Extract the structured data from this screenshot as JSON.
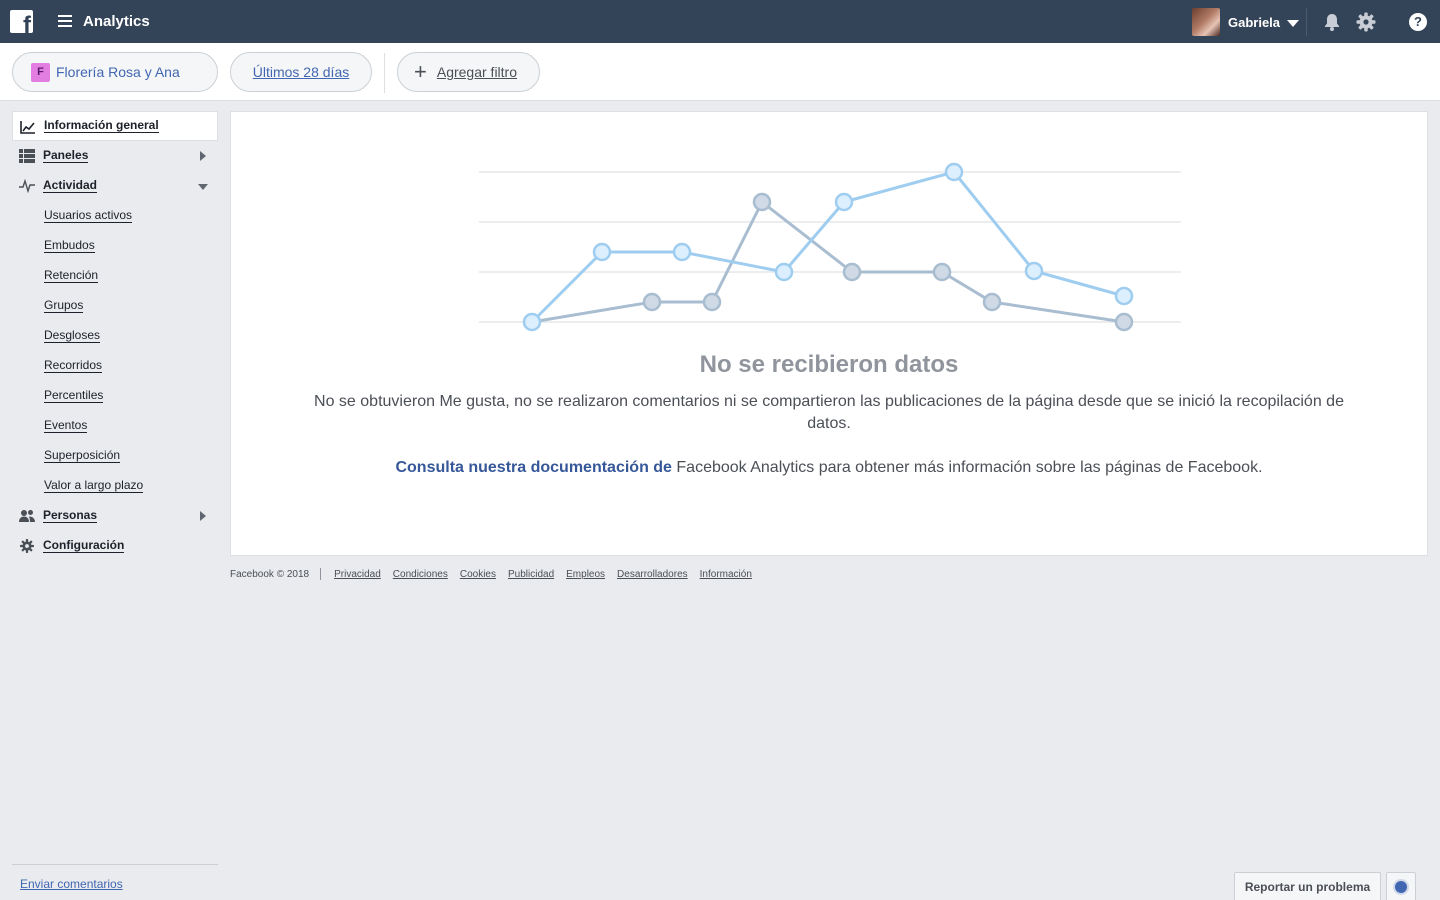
{
  "header": {
    "app_title": "Analytics",
    "user_name": "Gabriela",
    "icons": [
      "facebook-logo-icon",
      "menu-icon",
      "bell-icon",
      "gear-icon",
      "help-icon"
    ]
  },
  "filters": {
    "page_badge": "F",
    "page_name": "Florería Rosa y Ana",
    "date_range": "Últimos 28 días",
    "add_filter": "Agregar filtro"
  },
  "sidebar": {
    "overview": "Información general",
    "panels": "Paneles",
    "activity": "Actividad",
    "activity_items": [
      "Usuarios activos",
      "Embudos",
      "Retención",
      "Grupos",
      "Desgloses",
      "Recorridos",
      "Percentiles",
      "Eventos",
      "Superposición",
      "Valor a largo plazo"
    ],
    "people": "Personas",
    "settings": "Configuración",
    "feedback": "Enviar comentarios"
  },
  "empty_state": {
    "title": "No se recibieron datos",
    "description": "No se obtuvieron Me gusta, no se realizaron comentarios ni se compartieron las publicaciones de la página desde que se inició la recopilación de datos.",
    "doc_link": "Consulta nuestra documentación de",
    "doc_rest": " Facebook Analytics para obtener más información sobre las páginas de Facebook."
  },
  "footer": {
    "copyright": "Facebook © 2018",
    "links": [
      "Privacidad",
      "Condiciones",
      "Cookies",
      "Publicidad",
      "Empleos",
      "Desarrolladores",
      "Información"
    ]
  },
  "report_button": "Reportar un problema",
  "colors": {
    "topbar": "#344458",
    "link": "#4267b2",
    "series_light": "#9fcdf0",
    "series_dark": "#a9bdd0"
  }
}
